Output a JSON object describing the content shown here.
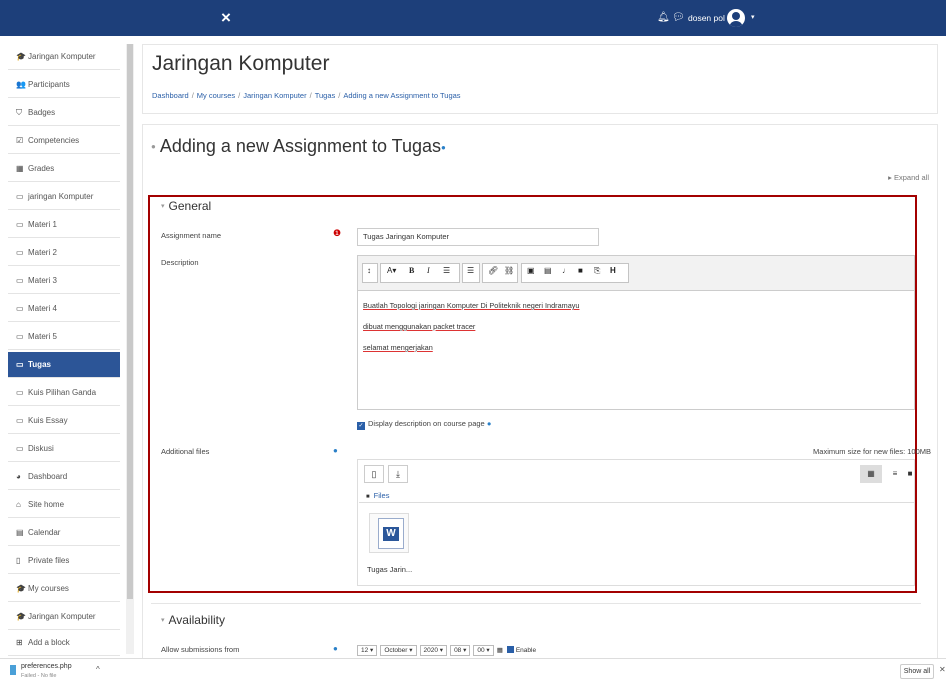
{
  "navbar": {
    "close": "×",
    "user_name": "dosen pol",
    "caret": "▾"
  },
  "sidebar": {
    "items": [
      {
        "icon": "graduation-cap-icon",
        "glyph": "🎓",
        "label": "Jaringan Komputer"
      },
      {
        "icon": "users-icon",
        "glyph": "👥",
        "label": "Participants"
      },
      {
        "icon": "badge-icon",
        "glyph": "⛉",
        "label": "Badges"
      },
      {
        "icon": "checkbox-icon",
        "glyph": "☑",
        "label": "Competencies"
      },
      {
        "icon": "grid-icon",
        "glyph": "▦",
        "label": "Grades"
      },
      {
        "icon": "folder-icon",
        "glyph": "▭",
        "label": "jaringan Komputer"
      },
      {
        "icon": "folder-icon",
        "glyph": "▭",
        "label": "Materi 1"
      },
      {
        "icon": "folder-icon",
        "glyph": "▭",
        "label": "Materi 2"
      },
      {
        "icon": "folder-icon",
        "glyph": "▭",
        "label": "Materi 3"
      },
      {
        "icon": "folder-icon",
        "glyph": "▭",
        "label": "Materi 4"
      },
      {
        "icon": "folder-icon",
        "glyph": "▭",
        "label": "Materi 5"
      },
      {
        "icon": "folder-icon",
        "glyph": "▭",
        "label": "Tugas",
        "active": true
      },
      {
        "icon": "folder-icon",
        "glyph": "▭",
        "label": "Kuis Pilihan Ganda"
      },
      {
        "icon": "folder-icon",
        "glyph": "▭",
        "label": "Kuis Essay"
      },
      {
        "icon": "folder-icon",
        "glyph": "▭",
        "label": "Diskusi"
      },
      {
        "icon": "dashboard-icon",
        "glyph": "◕",
        "label": "Dashboard"
      },
      {
        "icon": "home-icon",
        "glyph": "⌂",
        "label": "Site home"
      },
      {
        "icon": "calendar-icon",
        "glyph": "▤",
        "label": "Calendar"
      },
      {
        "icon": "file-icon",
        "glyph": "▯",
        "label": "Private files"
      },
      {
        "icon": "graduation-cap-icon",
        "glyph": "🎓",
        "label": "My courses"
      },
      {
        "icon": "graduation-cap-icon",
        "glyph": "🎓",
        "label": "Jaringan Komputer"
      },
      {
        "icon": "plus-square-icon",
        "glyph": "⊞",
        "label": "Add a block"
      }
    ]
  },
  "header": {
    "title": "Jaringan Komputer",
    "breadcrumb": [
      "Dashboard",
      "My courses",
      "Jaringan Komputer",
      "Tugas",
      "Adding a new Assignment to Tugas"
    ]
  },
  "main": {
    "heading": "Adding a new Assignment to Tugas",
    "expand_all": "Expand all",
    "general": {
      "title": "General",
      "assignment_name_label": "Assignment name",
      "assignment_name_value": "Tugas Jaringan Komputer",
      "description_label": "Description",
      "description_lines": [
        "Buatlah Topologi jaringan Komputer Di Politeknik negeri Indramayu",
        "dibuat menggunakan packet tracer",
        "selamat mengerjakan"
      ],
      "display_description_label": "Display description on course page",
      "additional_files_label": "Additional files",
      "max_size": "Maximum size for new files: 100MB",
      "files_path": "Files",
      "file_name": "Tugas Jarin..."
    },
    "availability": {
      "title": "Availability",
      "allow_submissions_label": "Allow submissions from",
      "day": "12",
      "month": "October",
      "year": "2020",
      "hour": "08",
      "minute": "00",
      "enable_label": "Enable"
    }
  },
  "download_bar": {
    "file_name": "preferences.php",
    "status": "Failed - No file",
    "show_all": "Show all"
  },
  "colors": {
    "navbar": "#1d3f7a",
    "active_item": "#2c5597",
    "highlight_border": "#a30000",
    "link": "#2a5fa8"
  }
}
